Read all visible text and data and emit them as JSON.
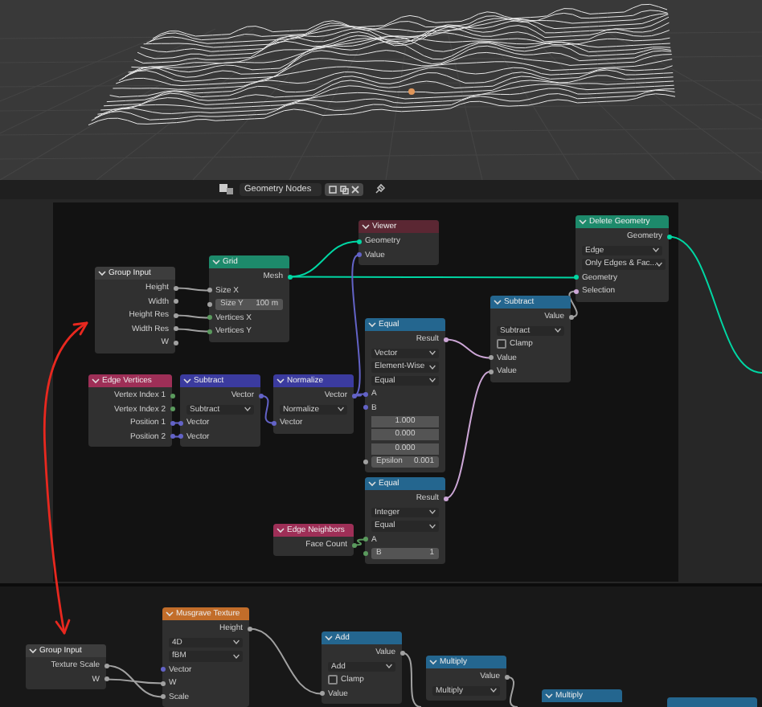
{
  "editor_header": {
    "title": "Geometry Nodes"
  },
  "nodes": [
    {
      "title": "Group Input",
      "kind": "group",
      "rows": [
        {
          "kind": "output",
          "label": "Height",
          "color": "#a1a1a1"
        },
        {
          "kind": "output",
          "label": "Width",
          "color": "#a1a1a1"
        },
        {
          "kind": "output",
          "label": "Height Res",
          "color": "#a1a1a1"
        },
        {
          "kind": "output",
          "label": "Width Res",
          "color": "#a1a1a1"
        },
        {
          "kind": "output",
          "label": "W",
          "color": "#a1a1a1"
        }
      ]
    },
    {
      "title": "Grid",
      "kind": "geometry",
      "rows": [
        {
          "kind": "output",
          "label": "Mesh",
          "color": "#00d6a3"
        },
        {
          "kind": "input",
          "label": "Size X",
          "color": "#a1a1a1"
        },
        {
          "kind": "field",
          "label": "Size Y",
          "value": "100 m",
          "color": "#a1a1a1"
        },
        {
          "kind": "input",
          "label": "Vertices X",
          "color": "#5a9a5d"
        },
        {
          "kind": "input",
          "label": "Vertices Y",
          "color": "#5a9a5d"
        }
      ]
    },
    {
      "title": "Viewer",
      "kind": "output",
      "rows": [
        {
          "kind": "input",
          "label": "Geometry",
          "color": "#00d6a3"
        },
        {
          "kind": "input",
          "label": "Value",
          "color": "#6363c7"
        }
      ]
    },
    {
      "title": "Delete Geometry",
      "kind": "geometry",
      "rows": [
        {
          "kind": "output",
          "label": "Geometry",
          "color": "#00d6a3"
        },
        {
          "kind": "dropdown",
          "label": "Edge"
        },
        {
          "kind": "dropdown",
          "label": "Only Edges & Fac..."
        },
        {
          "kind": "input",
          "label": "Geometry",
          "color": "#00d6a3"
        },
        {
          "kind": "input",
          "label": "Selection",
          "color": "#cca6d6"
        }
      ]
    },
    {
      "title": "Subtract",
      "kind": "converter",
      "rows": [
        {
          "kind": "output",
          "label": "Value",
          "color": "#a1a1a1"
        },
        {
          "kind": "dropdown",
          "label": "Subtract"
        },
        {
          "kind": "checkbox",
          "label": "Clamp",
          "checked": false
        },
        {
          "kind": "input",
          "label": "Value",
          "color": "#a1a1a1"
        },
        {
          "kind": "input",
          "label": "Value",
          "color": "#a1a1a1"
        }
      ]
    },
    {
      "title": "Equal",
      "kind": "converter",
      "rows": [
        {
          "kind": "output",
          "label": "Result",
          "color": "#cca6d6"
        },
        {
          "kind": "dropdown",
          "label": "Vector"
        },
        {
          "kind": "dropdown",
          "label": "Element-Wise"
        },
        {
          "kind": "dropdown",
          "label": "Equal"
        },
        {
          "kind": "input",
          "label": "A",
          "color": "#6363c7"
        },
        {
          "kind": "input",
          "label": "B",
          "color": "#6363c7"
        },
        {
          "kind": "number",
          "value": "1.000"
        },
        {
          "kind": "number",
          "value": "0.000"
        },
        {
          "kind": "number",
          "value": "0.000"
        },
        {
          "kind": "field",
          "label": "Epsilon",
          "value": "0.001",
          "color": "#a1a1a1"
        }
      ]
    },
    {
      "title": "Edge Vertices",
      "kind": "input",
      "rows": [
        {
          "kind": "output",
          "label": "Vertex Index 1",
          "color": "#5a9a5d"
        },
        {
          "kind": "output",
          "label": "Vertex Index 2",
          "color": "#5a9a5d"
        },
        {
          "kind": "output",
          "label": "Position 1",
          "color": "#6363c7"
        },
        {
          "kind": "output",
          "label": "Position 2",
          "color": "#6363c7"
        }
      ]
    },
    {
      "title": "Subtract",
      "kind": "vector",
      "rows": [
        {
          "kind": "output",
          "label": "Vector",
          "color": "#6363c7"
        },
        {
          "kind": "dropdown",
          "label": "Subtract"
        },
        {
          "kind": "input",
          "label": "Vector",
          "color": "#6363c7"
        },
        {
          "kind": "input",
          "label": "Vector",
          "color": "#6363c7"
        }
      ]
    },
    {
      "title": "Normalize",
      "kind": "vector",
      "rows": [
        {
          "kind": "output",
          "label": "Vector",
          "color": "#6363c7"
        },
        {
          "kind": "dropdown",
          "label": "Normalize"
        },
        {
          "kind": "input",
          "label": "Vector",
          "color": "#6363c7"
        }
      ]
    },
    {
      "title": "Equal",
      "kind": "converter",
      "rows": [
        {
          "kind": "output",
          "label": "Result",
          "color": "#cca6d6"
        },
        {
          "kind": "dropdown",
          "label": "Integer"
        },
        {
          "kind": "dropdown",
          "label": "Equal"
        },
        {
          "kind": "input",
          "label": "A",
          "color": "#5a9a5d"
        },
        {
          "kind": "field",
          "label": "B",
          "value": "1",
          "color": "#5a9a5d"
        }
      ]
    },
    {
      "title": "Edge Neighbors",
      "kind": "input",
      "rows": [
        {
          "kind": "output",
          "label": "Face Count",
          "color": "#5a9a5d"
        }
      ]
    },
    {
      "title": "Group Input",
      "kind": "group",
      "rows": [
        {
          "kind": "output",
          "label": "Texture Scale",
          "color": "#a1a1a1"
        },
        {
          "kind": "output",
          "label": "W",
          "color": "#a1a1a1"
        }
      ]
    },
    {
      "title": "Musgrave Texture",
      "kind": "texture",
      "rows": [
        {
          "kind": "output",
          "label": "Height",
          "color": "#a1a1a1"
        },
        {
          "kind": "dropdown",
          "label": "4D"
        },
        {
          "kind": "dropdown",
          "label": "fBM"
        },
        {
          "kind": "input",
          "label": "Vector",
          "color": "#6363c7"
        },
        {
          "kind": "input",
          "label": "W",
          "color": "#a1a1a1"
        },
        {
          "kind": "input",
          "label": "Scale",
          "color": "#a1a1a1"
        }
      ]
    },
    {
      "title": "Add",
      "kind": "converter",
      "rows": [
        {
          "kind": "output",
          "label": "Value",
          "color": "#a1a1a1"
        },
        {
          "kind": "dropdown",
          "label": "Add"
        },
        {
          "kind": "checkbox",
          "label": "Clamp",
          "checked": false
        },
        {
          "kind": "input",
          "label": "Value",
          "color": "#a1a1a1"
        }
      ]
    },
    {
      "title": "Multiply",
      "kind": "converter",
      "rows": [
        {
          "kind": "output",
          "label": "Value",
          "color": "#a1a1a1"
        },
        {
          "kind": "dropdown",
          "label": "Multiply"
        }
      ]
    },
    {
      "title": "Multiply",
      "kind": "converter"
    },
    {
      "kind": "converter"
    }
  ]
}
